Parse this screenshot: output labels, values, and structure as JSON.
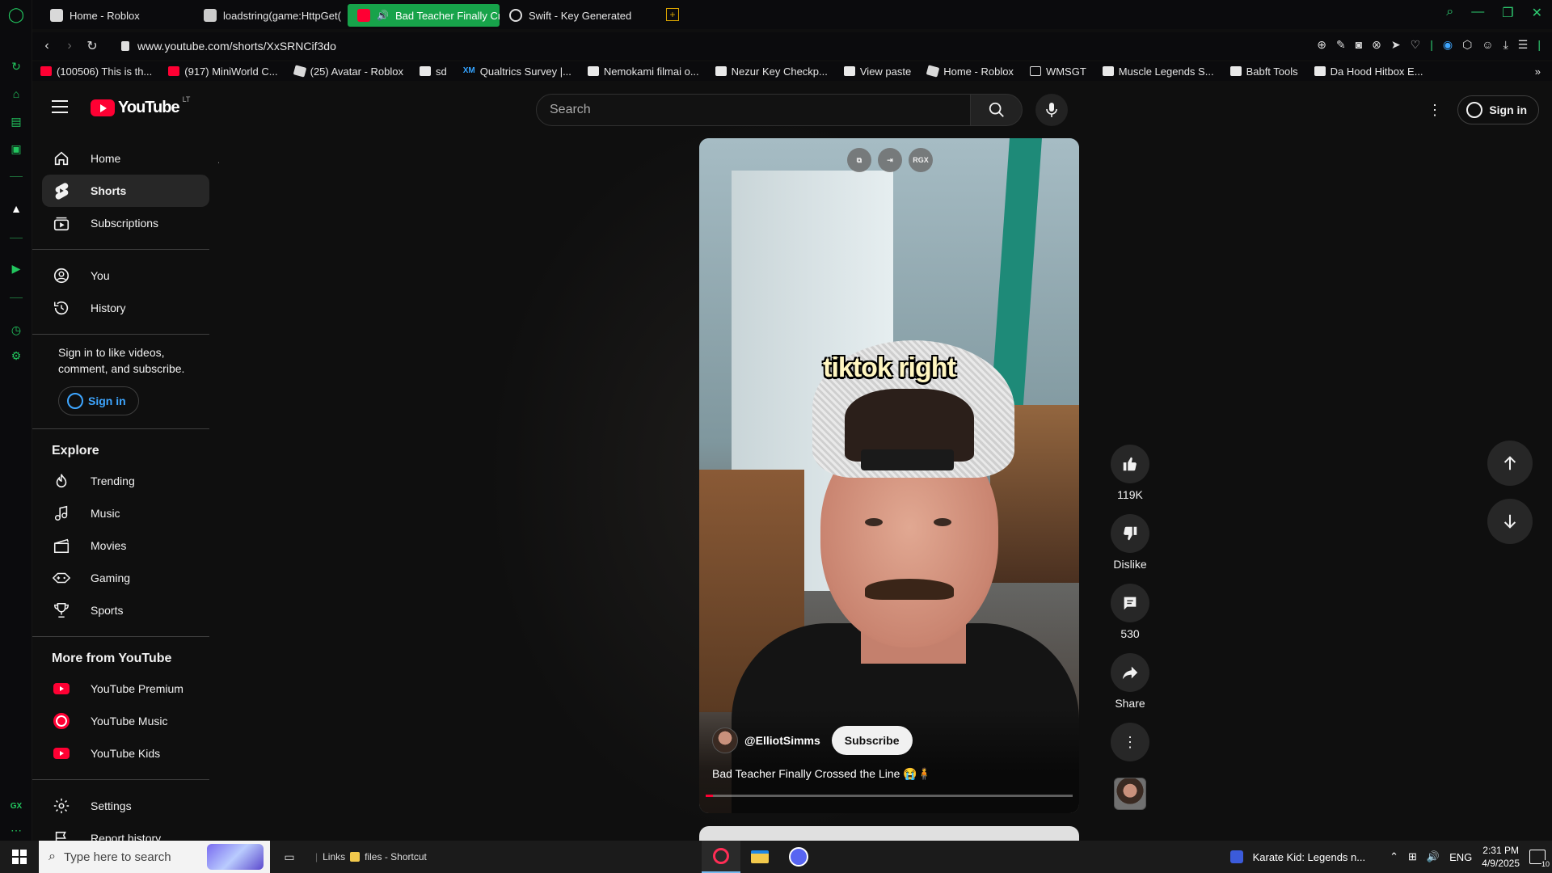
{
  "browser": {
    "tabs": [
      {
        "title": "Home - Roblox",
        "favicon": "roblox-icon",
        "active": false
      },
      {
        "title": "loadstring(game:HttpGet(",
        "favicon": "document-icon",
        "active": false
      },
      {
        "title": "Bad Teacher Finally Cr",
        "favicon": "youtube-icon",
        "active": true
      },
      {
        "title": "Swift - Key Generated",
        "favicon": "globe-icon",
        "active": false
      }
    ],
    "new_tab": "+",
    "url": "www.youtube.com/shorts/XxSRNCif3do",
    "bookmarks": [
      {
        "label": "(100506) This is th...",
        "icon": "youtube-icon"
      },
      {
        "label": "(917) MiniWorld C...",
        "icon": "youtube-icon"
      },
      {
        "label": "(25) Avatar - Roblox",
        "icon": "roblox-icon"
      },
      {
        "label": "sd",
        "icon": "document-icon"
      },
      {
        "label": "Qualtrics Survey |...",
        "icon": "xm-icon"
      },
      {
        "label": "Nemokami filmai o...",
        "icon": "document-icon"
      },
      {
        "label": "Nezur Key Checkp...",
        "icon": "document-icon"
      },
      {
        "label": "View paste",
        "icon": "document-icon"
      },
      {
        "label": "Home - Roblox",
        "icon": "roblox-icon"
      },
      {
        "label": "WMSGT",
        "icon": "folder-icon"
      },
      {
        "label": "Muscle Legends S...",
        "icon": "document-icon"
      },
      {
        "label": "Babft Tools",
        "icon": "document-icon"
      },
      {
        "label": "Da Hood Hitbox E...",
        "icon": "grid-icon"
      }
    ],
    "xm_mark": "XM",
    "gx_label": "GX"
  },
  "youtube": {
    "logo_text": "YouTube",
    "country_code": "LT",
    "search_placeholder": "Search",
    "sign_in": "Sign in",
    "sidebar": {
      "main": [
        {
          "label": "Home",
          "icon": "home-icon"
        },
        {
          "label": "Shorts",
          "icon": "shorts-icon",
          "active": true
        },
        {
          "label": "Subscriptions",
          "icon": "subscriptions-icon"
        }
      ],
      "you": [
        {
          "label": "You",
          "icon": "user-icon"
        },
        {
          "label": "History",
          "icon": "history-icon"
        }
      ],
      "signin_prompt": "Sign in to like videos, comment, and subscribe.",
      "signin_button": "Sign in",
      "explore_heading": "Explore",
      "explore": [
        {
          "label": "Trending",
          "icon": "trending-icon"
        },
        {
          "label": "Music",
          "icon": "music-icon"
        },
        {
          "label": "Movies",
          "icon": "movies-icon"
        },
        {
          "label": "Gaming",
          "icon": "gaming-icon"
        },
        {
          "label": "Sports",
          "icon": "sports-icon"
        }
      ],
      "more_heading": "More from YouTube",
      "more": [
        {
          "label": "YouTube Premium",
          "icon": "youtube-premium-icon"
        },
        {
          "label": "YouTube Music",
          "icon": "youtube-music-icon"
        },
        {
          "label": "YouTube Kids",
          "icon": "youtube-kids-icon"
        }
      ],
      "settings": [
        {
          "label": "Settings",
          "icon": "settings-icon"
        },
        {
          "label": "Report history",
          "icon": "flag-icon"
        }
      ]
    },
    "short": {
      "caption": "tiktok right",
      "tool_label": "RGX",
      "channel": "@ElliotSimms",
      "subscribe": "Subscribe",
      "title": "Bad Teacher Finally Crossed the Line 😭🧍",
      "progress": 0.02
    },
    "actions": {
      "likes": "119K",
      "dislike": "Dislike",
      "comments": "530",
      "share": "Share"
    }
  },
  "taskbar": {
    "search_placeholder": "Type here to search",
    "links_label": "Links",
    "shortcut_label": "files - Shortcut",
    "now_playing": "Karate Kid: Legends n...",
    "language": "ENG",
    "time": "2:31 PM",
    "date": "4/9/2025",
    "notifications": "10"
  },
  "colors": {
    "gx_accent": "#17a34a",
    "youtube_red": "#ff0033",
    "link_blue": "#3ea6ff"
  }
}
